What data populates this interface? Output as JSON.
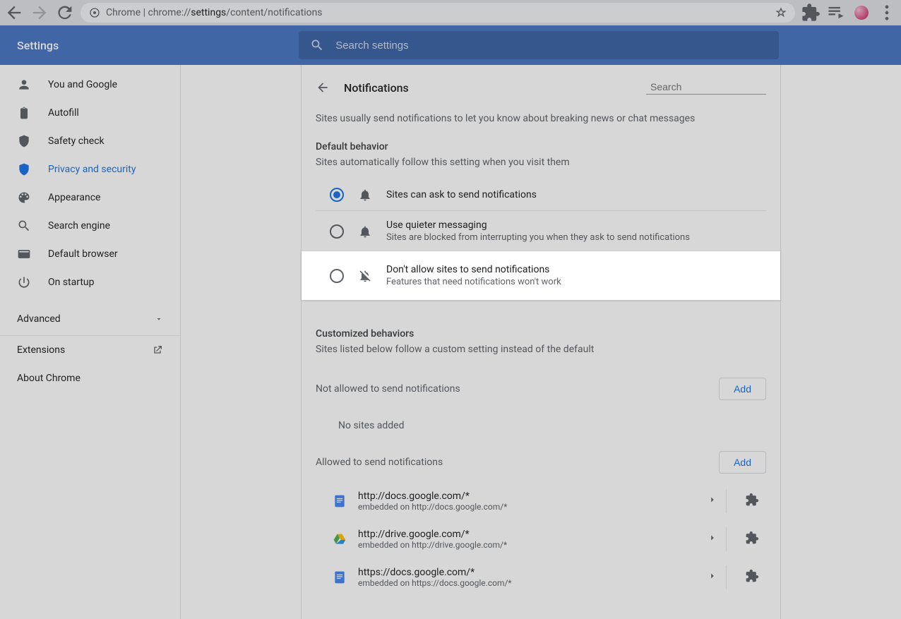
{
  "browser": {
    "url_prefix": "Chrome",
    "url_part1": "chrome://",
    "url_part2": "settings",
    "url_part3": "/content/notifications"
  },
  "header": {
    "title": "Settings",
    "search_placeholder": "Search settings"
  },
  "sidebar": {
    "items": [
      {
        "label": "You and Google"
      },
      {
        "label": "Autofill"
      },
      {
        "label": "Safety check"
      },
      {
        "label": "Privacy and security"
      },
      {
        "label": "Appearance"
      },
      {
        "label": "Search engine"
      },
      {
        "label": "Default browser"
      },
      {
        "label": "On startup"
      }
    ],
    "advanced": "Advanced",
    "extensions": "Extensions",
    "about": "About Chrome"
  },
  "page": {
    "title": "Notifications",
    "search_placeholder": "Search",
    "description": "Sites usually send notifications to let you know about breaking news or chat messages",
    "default_behavior_title": "Default behavior",
    "default_behavior_sub": "Sites automatically follow this setting when you visit them",
    "radios": [
      {
        "title": "Sites can ask to send notifications",
        "sub": ""
      },
      {
        "title": "Use quieter messaging",
        "sub": "Sites are blocked from interrupting you when they ask to send notifications"
      },
      {
        "title": "Don't allow sites to send notifications",
        "sub": "Features that need notifications won't work"
      }
    ],
    "customized_title": "Customized behaviors",
    "customized_sub": "Sites listed below follow a custom setting instead of the default",
    "not_allowed_label": "Not allowed to send notifications",
    "add_label": "Add",
    "no_sites": "No sites added",
    "allowed_label": "Allowed to send notifications",
    "allowed_sites": [
      {
        "url": "http://docs.google.com/*",
        "embedded": "embedded on http://docs.google.com/*",
        "icon": "docs"
      },
      {
        "url": "http://drive.google.com/*",
        "embedded": "embedded on http://drive.google.com/*",
        "icon": "drive"
      },
      {
        "url": "https://docs.google.com/*",
        "embedded": "embedded on https://docs.google.com/*",
        "icon": "docs"
      }
    ]
  }
}
